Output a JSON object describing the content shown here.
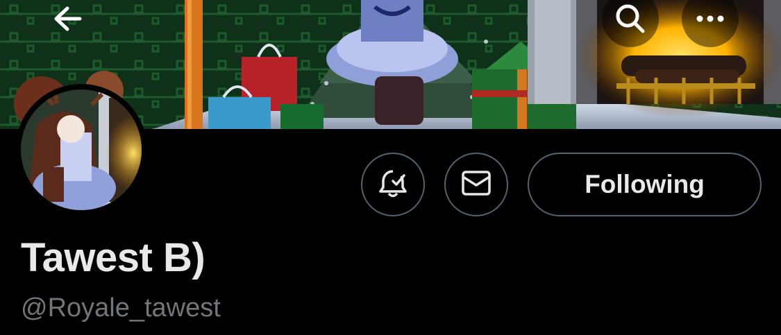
{
  "header": {
    "back_icon": "arrow-left-icon",
    "search_icon": "search-icon",
    "more_icon": "more-horizontal-icon"
  },
  "profile": {
    "display_name": "Tawest B)",
    "handle": "@Royale_tawest"
  },
  "actions": {
    "notify_icon": "bell-check-icon",
    "message_icon": "envelope-icon",
    "following_label": "Following"
  },
  "colors": {
    "background": "#000000",
    "text_primary": "#e7e9ea",
    "text_secondary": "#71767b",
    "button_border": "#536471"
  }
}
